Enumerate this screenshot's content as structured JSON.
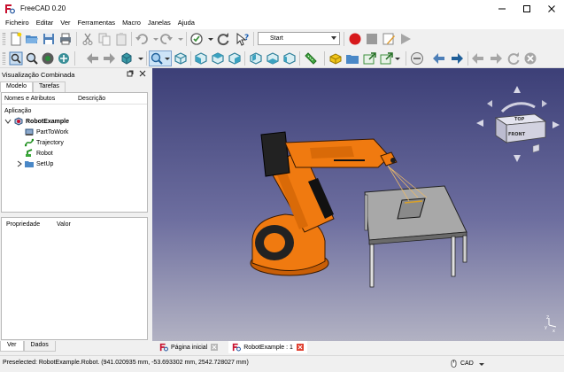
{
  "window": {
    "title": "FreeCAD 0.20"
  },
  "menu": [
    "Ficheiro",
    "Editar",
    "Ver",
    "Ferramentas",
    "Macro",
    "Janelas",
    "Ajuda"
  ],
  "workbench": {
    "selected": "Start"
  },
  "combo_view": {
    "title": "Visualização Combinada",
    "tabs": [
      "Modelo",
      "Tarefas"
    ],
    "tree_columns": [
      "Nomes e Atributos",
      "Descrição"
    ],
    "tree_root_label": "Aplicação",
    "document": "RobotExample",
    "items": [
      {
        "label": "PartToWork",
        "icon": "part-icon"
      },
      {
        "label": "Trajectory",
        "icon": "trajectory-icon"
      },
      {
        "label": "Robot",
        "icon": "robot-icon"
      },
      {
        "label": "SetUp",
        "icon": "folder-icon"
      }
    ],
    "property_columns": [
      "Propriedade",
      "Valor"
    ],
    "property_tabs": [
      "Ver",
      "Dados"
    ]
  },
  "navcube": {
    "top": "TOP",
    "front": "FRONT"
  },
  "axes": {
    "x": "x",
    "y": "y",
    "z": "z"
  },
  "doc_tabs": [
    {
      "label": "Página inicial"
    },
    {
      "label": "RobotExample : 1"
    }
  ],
  "status": {
    "text": "Preselected: RobotExample.Robot. (941.020935 mm, -53.693302 mm, 2542.728027 mm)",
    "nav_style": "CAD"
  },
  "colors": {
    "viewport_top": "#3c3f77",
    "viewport_bottom": "#b2b2c3",
    "robot": "#f07a10",
    "table": "#a8a8a8"
  }
}
